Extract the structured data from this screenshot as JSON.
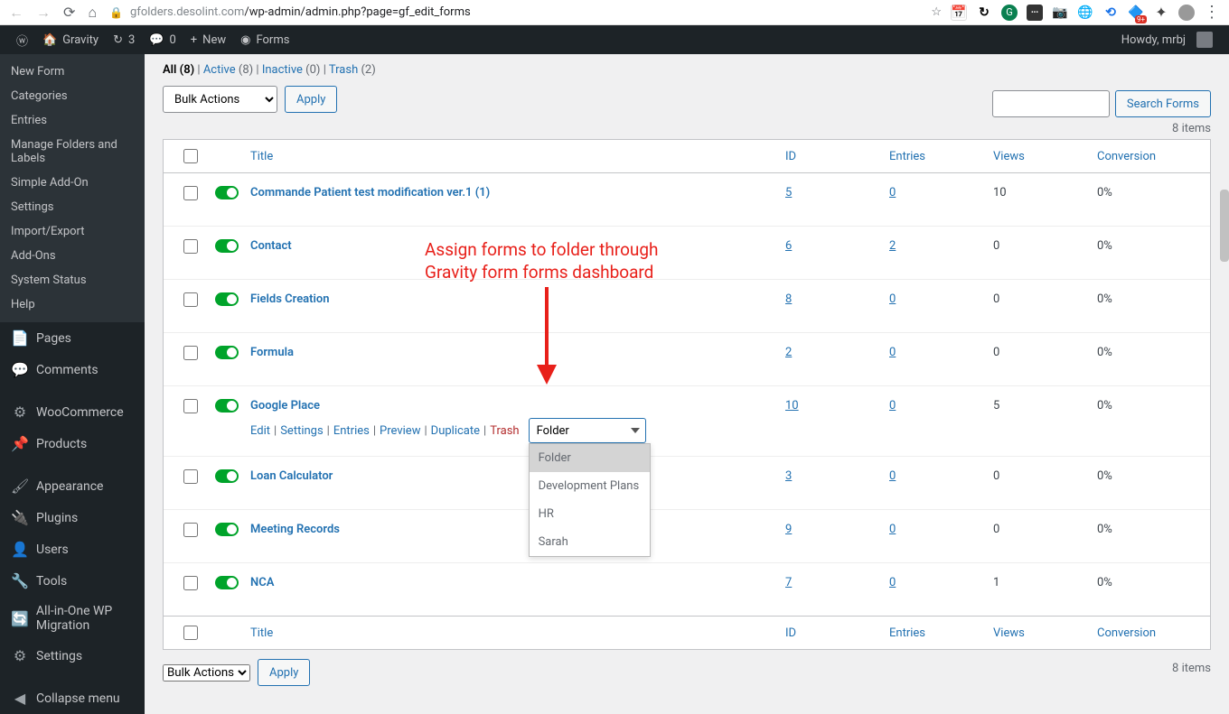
{
  "url": {
    "host": "gfolders.desolint.com",
    "path": "/wp-admin/admin.php?page=gf_edit_forms"
  },
  "adminbar": {
    "site": "Gravity",
    "updates": "3",
    "comments": "0",
    "new": "New",
    "forms": "Forms",
    "howdy": "Howdy, mrbj"
  },
  "sidebar": {
    "submenu": [
      "New Form",
      "Categories",
      "Entries",
      "Manage Folders and Labels",
      "Simple Add-On",
      "Settings",
      "Import/Export",
      "Add-Ons",
      "System Status",
      "Help"
    ],
    "main": [
      {
        "icon": "📄",
        "label": "Pages"
      },
      {
        "icon": "💬",
        "label": "Comments"
      },
      {
        "icon": "⚙",
        "label": "WooCommerce"
      },
      {
        "icon": "📌",
        "label": "Products"
      },
      {
        "icon": "🖌",
        "label": "Appearance"
      },
      {
        "icon": "🔌",
        "label": "Plugins"
      },
      {
        "icon": "👤",
        "label": "Users"
      },
      {
        "icon": "🔧",
        "label": "Tools"
      },
      {
        "icon": "🔄",
        "label": "All-in-One WP Migration"
      },
      {
        "icon": "⚙",
        "label": "Settings"
      },
      {
        "icon": "◀",
        "label": "Collapse menu"
      }
    ]
  },
  "filters": {
    "all": "All",
    "all_n": "(8)",
    "active": "Active",
    "active_n": "(8)",
    "inactive": "Inactive",
    "inactive_n": "(0)",
    "trash": "Trash",
    "trash_n": "(2)"
  },
  "bulk": {
    "label": "Bulk Actions",
    "apply": "Apply"
  },
  "search": {
    "button": "Search Forms"
  },
  "count": "8 items",
  "headers": {
    "title": "Title",
    "id": "ID",
    "entries": "Entries",
    "views": "Views",
    "conv": "Conversion"
  },
  "rows": [
    {
      "title": "Commande Patient test modification ver.1 (1)",
      "id": "5",
      "entries": "0",
      "views": "10",
      "conv": "0%"
    },
    {
      "title": "Contact",
      "id": "6",
      "entries": "2",
      "views": "0",
      "conv": "0%"
    },
    {
      "title": "Fields Creation",
      "id": "8",
      "entries": "0",
      "views": "0",
      "conv": "0%"
    },
    {
      "title": "Formula",
      "id": "2",
      "entries": "0",
      "views": "0",
      "conv": "0%"
    },
    {
      "title": "Google Place",
      "id": "10",
      "entries": "0",
      "views": "5",
      "conv": "0%",
      "actions": true
    },
    {
      "title": "Loan Calculator",
      "id": "3",
      "entries": "0",
      "views": "0",
      "conv": "0%"
    },
    {
      "title": "Meeting Records",
      "id": "9",
      "entries": "0",
      "views": "0",
      "conv": "0%"
    },
    {
      "title": "NCA",
      "id": "7",
      "entries": "0",
      "views": "1",
      "conv": "0%"
    }
  ],
  "row_actions": {
    "edit": "Edit",
    "settings": "Settings",
    "entries": "Entries",
    "preview": "Preview",
    "duplicate": "Duplicate",
    "trash": "Trash"
  },
  "folder_select": {
    "label": "Folder",
    "options": [
      "Folder",
      "Development Plans",
      "HR",
      "Sarah"
    ]
  },
  "annotation": {
    "l1": "Assign forms to folder through",
    "l2": "Gravity form forms dashboard"
  }
}
